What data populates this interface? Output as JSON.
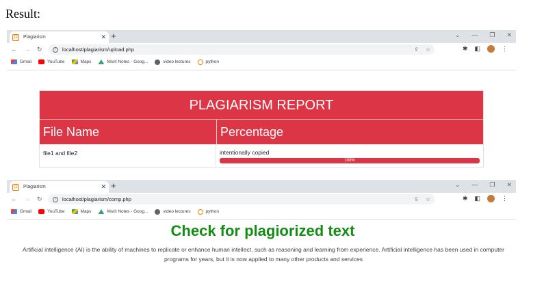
{
  "result_label": "Result:",
  "window1": {
    "tab_title": "Plagiarism",
    "url": "localhost/plagiarism/upload.php"
  },
  "window2": {
    "tab_title": "Plagiarism",
    "url": "localhost/plagiarism/comp.php"
  },
  "bookmarks": [
    "Gmail",
    "YouTube",
    "Maps",
    "Msrit Notes - Goog...",
    "video lectures",
    "python"
  ],
  "report": {
    "title": "PLAGIARISM REPORT",
    "col_file": "File Name",
    "col_percent": "Percentage",
    "row_file": "file1 and file2",
    "row_status": "intentionally copied",
    "progress_label": "100%",
    "progress_value": 100
  },
  "compare": {
    "heading": "Check for plagiorized text",
    "text": "Artificial intelligence (AI) is the ability of machines to replicate or enhance human intellect, such as reasoning and learning from experience. Artificial intelligence has been used in computer programs for years, but it is now applied to many other products and services"
  },
  "colors": {
    "accent_red": "#dc3545",
    "heading_green": "#138d13"
  }
}
